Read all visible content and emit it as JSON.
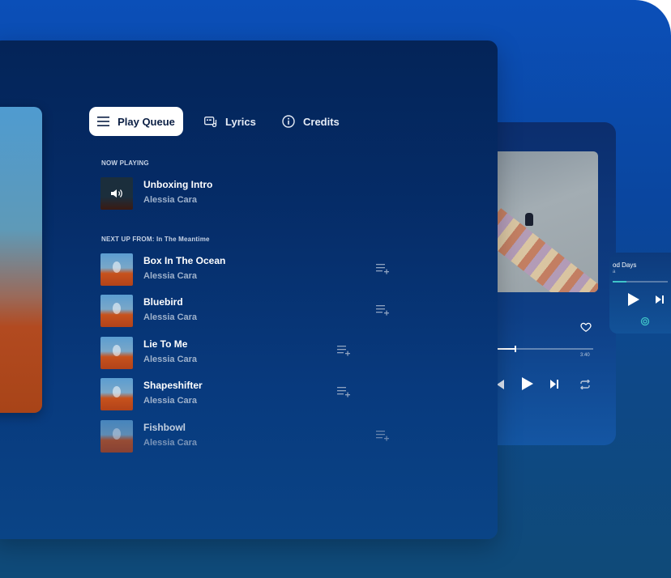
{
  "tabs": [
    {
      "label": "Play Queue",
      "icon": "list-icon",
      "active": true
    },
    {
      "label": "Lyrics",
      "icon": "lyrics-icon",
      "active": false
    },
    {
      "label": "Credits",
      "icon": "info-icon",
      "active": false
    }
  ],
  "now_playing": {
    "section_label": "NOW PLAYING",
    "title": "Unboxing Intro",
    "artist": "Alessia Cara",
    "icon": "speaker-icon"
  },
  "next_up": {
    "section_label": "NEXT UP FROM: In The Meantime",
    "tracks": [
      {
        "title": "Box In The Ocean",
        "artist": "Alessia Cara"
      },
      {
        "title": "Bluebird",
        "artist": "Alessia Cara"
      },
      {
        "title": "Lie To Me",
        "artist": "Alessia Cara"
      },
      {
        "title": "Shapeshifter",
        "artist": "Alessia Cara"
      },
      {
        "title": "Fishbowl",
        "artist": "Alessia Cara"
      }
    ]
  },
  "player": {
    "time_end": "3:40",
    "progress": 0.18
  },
  "mini_player": {
    "title": "od Days",
    "subtitle": "a",
    "progress": 0.25
  },
  "colors": {
    "accent": "#40c4c8",
    "panel": "#052b66",
    "active_tab_bg": "#ffffff"
  }
}
